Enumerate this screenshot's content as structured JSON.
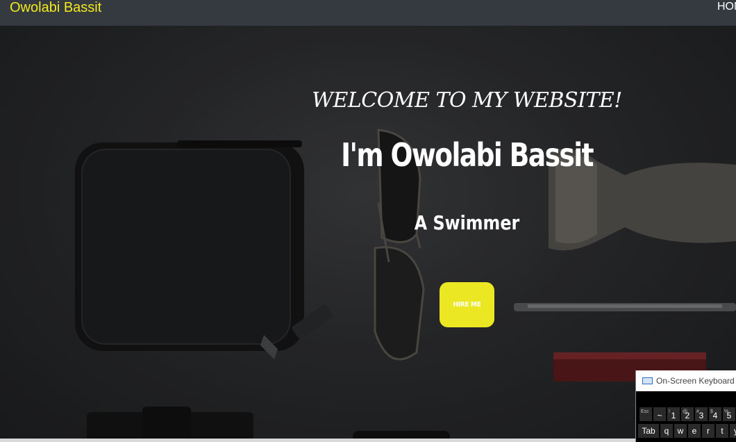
{
  "navbar": {
    "brand": "Owolabi Bassit",
    "home_link": "HOM",
    "brand_color": "#f2ea1d",
    "background": "#343a40"
  },
  "hero": {
    "welcome": "WELCOME TO MY WEBSITE!",
    "name": "I'm Owolabi Bassit",
    "role": "A Swimmer",
    "hire_button": "HIRE ME",
    "button_color": "#ece723"
  },
  "osk": {
    "title": "On-Screen Keyboard",
    "row1": [
      {
        "sup": "Esc",
        "main": ""
      },
      {
        "sup": "",
        "main": "~"
      },
      {
        "sup": "!",
        "main": "1"
      },
      {
        "sup": "@",
        "main": "2"
      },
      {
        "sup": "#",
        "main": "3"
      },
      {
        "sup": "$",
        "main": "4"
      },
      {
        "sup": "%",
        "main": "5"
      }
    ],
    "row2": [
      "Tab",
      "q",
      "w",
      "e",
      "r",
      "t",
      "y"
    ]
  }
}
